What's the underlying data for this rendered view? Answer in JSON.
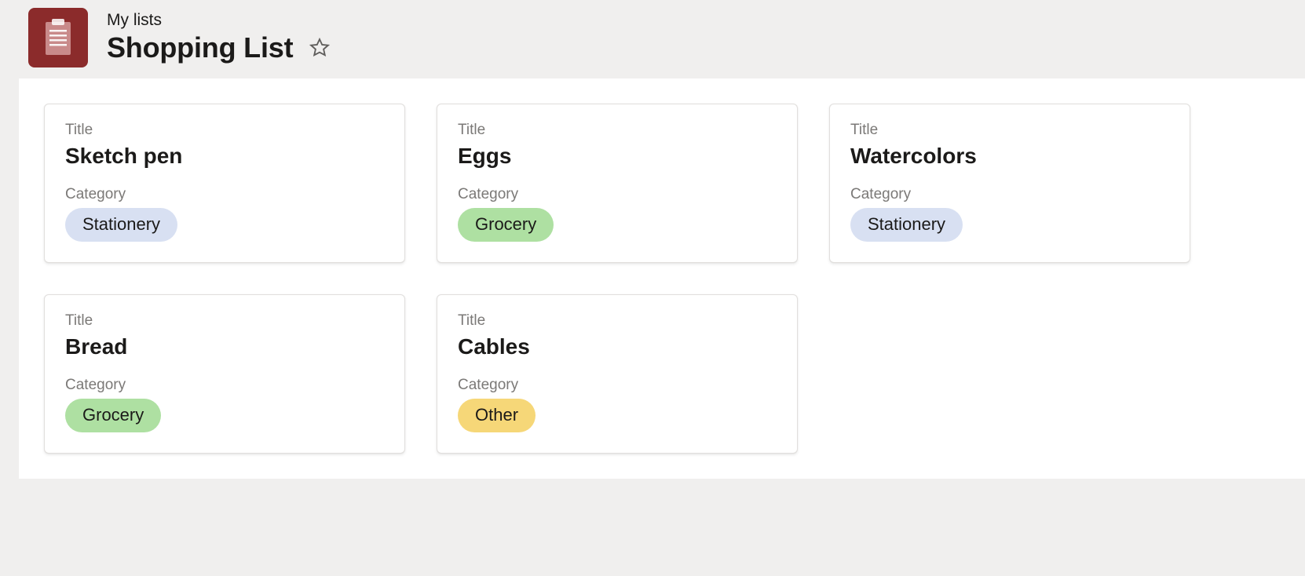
{
  "header": {
    "breadcrumb": "My lists",
    "title": "Shopping List"
  },
  "labels": {
    "title": "Title",
    "category": "Category"
  },
  "items": [
    {
      "title": "Sketch pen",
      "category": "Stationery",
      "category_key": "stationery"
    },
    {
      "title": "Eggs",
      "category": "Grocery",
      "category_key": "grocery"
    },
    {
      "title": "Watercolors",
      "category": "Stationery",
      "category_key": "stationery"
    },
    {
      "title": "Bread",
      "category": "Grocery",
      "category_key": "grocery"
    },
    {
      "title": "Cables",
      "category": "Other",
      "category_key": "other"
    }
  ],
  "colors": {
    "tile": "#8b2b2b",
    "stationery": "#d8e0f2",
    "grocery": "#aee0a2",
    "other": "#f6d778"
  }
}
